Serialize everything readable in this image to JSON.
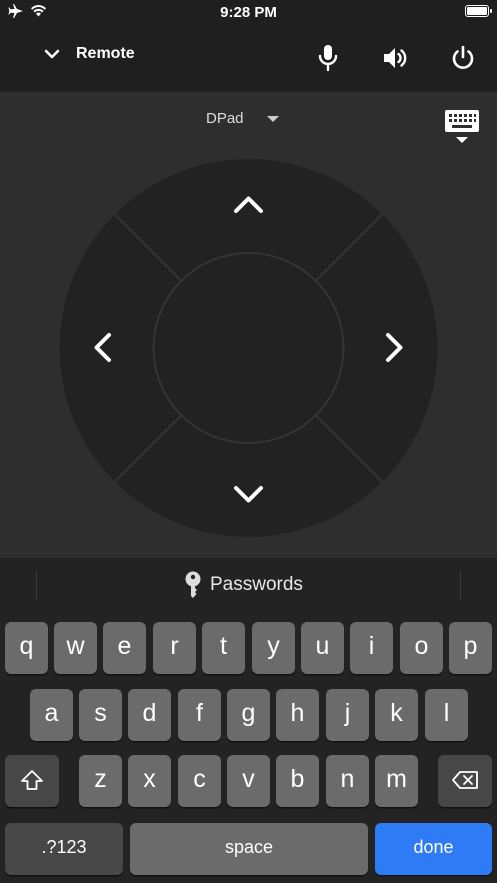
{
  "status": {
    "time": "9:28 PM",
    "icons": [
      "airplane-icon",
      "wifi-icon",
      "battery-icon"
    ]
  },
  "topbar": {
    "title": "Remote",
    "icons": [
      "chevron-down-icon",
      "microphone-icon",
      "volume-icon",
      "power-icon"
    ]
  },
  "dpad": {
    "mode_label": "DPad",
    "icons": [
      "caret-down-icon",
      "keyboard-icon",
      "arrow-up-icon",
      "arrow-down-icon",
      "arrow-left-icon",
      "arrow-right-icon"
    ]
  },
  "keyboard": {
    "suggestion": "Passwords",
    "row1": [
      "q",
      "w",
      "e",
      "r",
      "t",
      "y",
      "u",
      "i",
      "o",
      "p"
    ],
    "row2": [
      "a",
      "s",
      "d",
      "f",
      "g",
      "h",
      "j",
      "k",
      "l"
    ],
    "row3": [
      "z",
      "x",
      "c",
      "v",
      "b",
      "n",
      "m"
    ],
    "numbers_label": ".?123",
    "space_label": "space",
    "done_label": "done"
  },
  "colors": {
    "accent": "#2f7bf5",
    "key": "#6b6b6b",
    "background": "#2b2b2b"
  }
}
